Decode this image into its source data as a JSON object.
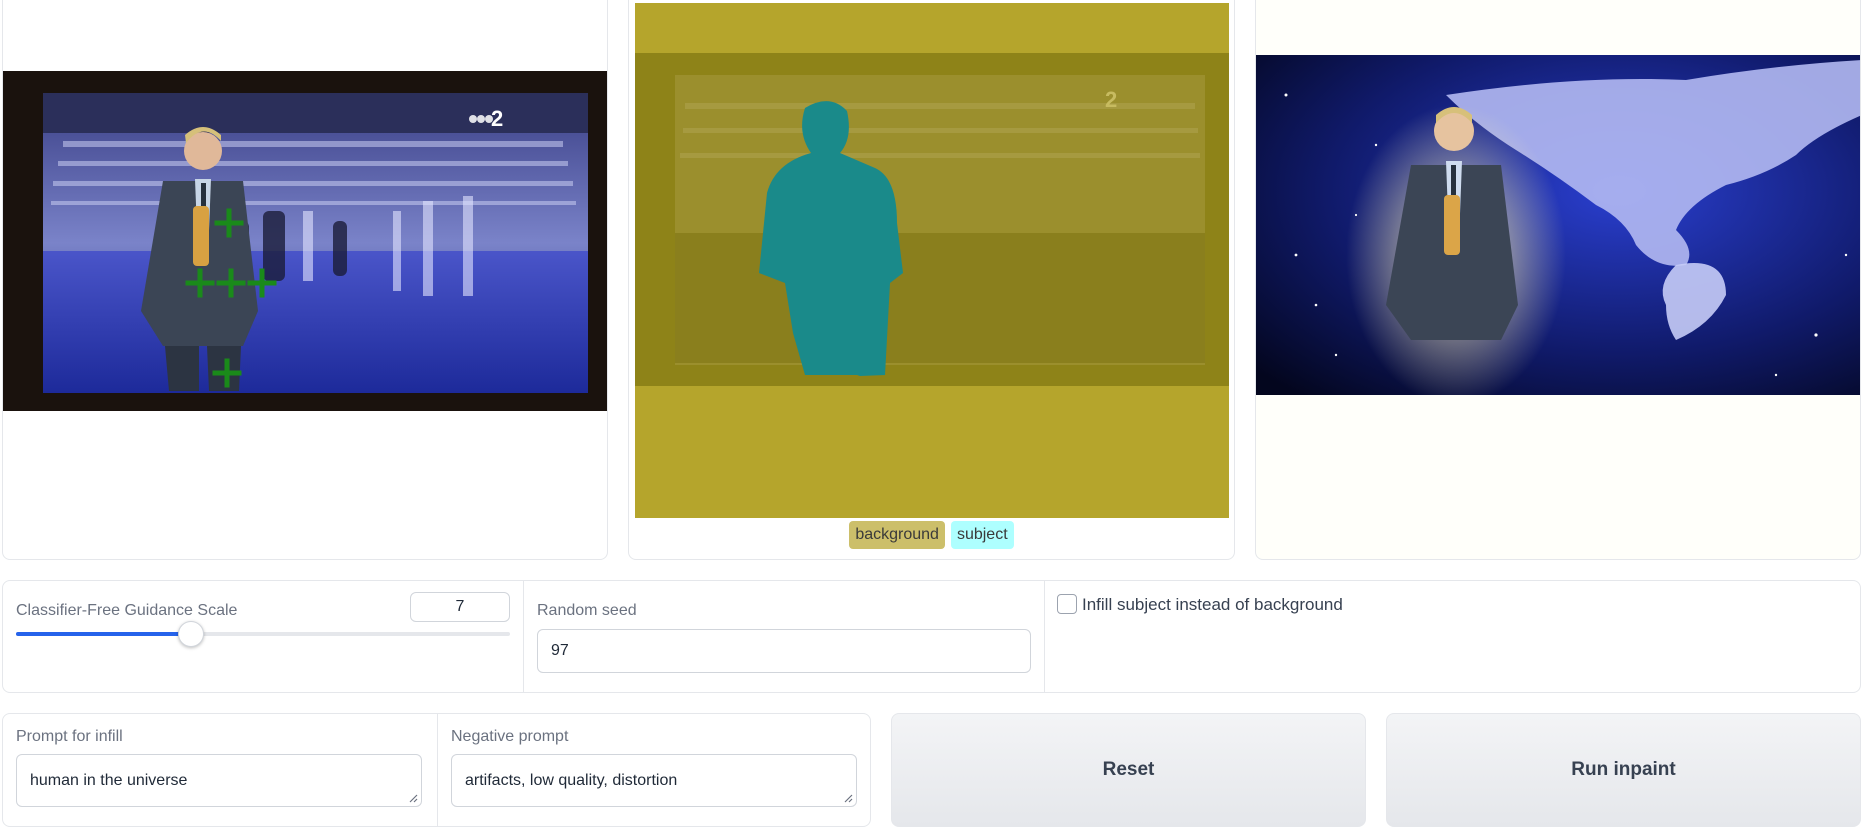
{
  "images": {
    "input_alt": "input image with selected points",
    "mask_alt": "segmentation mask",
    "output_alt": "inpainted result",
    "overlay_text": "2"
  },
  "mask_legend": {
    "background_label": "background",
    "subject_label": "subject",
    "background_color": "#ccbf6a",
    "subject_color": "#aeffff"
  },
  "controls": {
    "cfg_label": "Classifier-Free Guidance Scale",
    "cfg_value": "7",
    "cfg_fraction": 0.355,
    "seed_label": "Random seed",
    "seed_value": "97",
    "infill_checkbox_label": "Infill subject instead of background",
    "infill_checked": false
  },
  "prompts": {
    "prompt_label": "Prompt for infill",
    "prompt_value": "human in the universe",
    "negative_label": "Negative prompt",
    "negative_value": "artifacts, low quality, distortion"
  },
  "buttons": {
    "reset_label": "Reset",
    "run_label": "Run inpaint"
  },
  "colors": {
    "accent": "#2563eb",
    "marker": "#1a8a1a"
  }
}
